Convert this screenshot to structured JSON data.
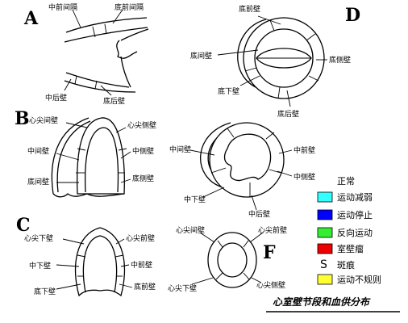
{
  "panels": {
    "A": {
      "letter": "A",
      "labels": {
        "mid_anterior_septum": "中前间隔",
        "basal_anterior_septum": "底前间隔",
        "mid_posterior_wall": "中后壁",
        "basal_posterior_wall": "底后壁"
      }
    },
    "B": {
      "letter": "B",
      "left_labels": {
        "apical_septum": "心尖间壁",
        "apical_lateral": "心尖侧壁",
        "mid_septum": "中间壁",
        "mid_lateral": "中侧壁",
        "basal_septum": "底间壁",
        "basal_lateral": "底侧壁"
      },
      "right_labels": {
        "mid_septum": "中间壁",
        "mid_anterior": "中前壁",
        "mid_lateral": "中侧壁",
        "mid_inferior": "中下壁",
        "mid_posterior": "中后壁"
      }
    },
    "C": {
      "letter": "C",
      "labels": {
        "apical_inferior": "心尖下壁",
        "apical_anterior": "心尖前壁",
        "mid_inferior": "中下壁",
        "mid_anterior": "中前壁",
        "basal_inferior": "底下壁",
        "basal_anterior": "底前壁"
      }
    },
    "D": {
      "letter": "D",
      "labels": {
        "basal_anterior": "底前壁",
        "basal_septum": "底间壁",
        "basal_inferior": "底下壁",
        "basal_lateral": "底侧壁",
        "basal_posterior": "底后壁"
      }
    },
    "F": {
      "letter": "F",
      "labels": {
        "apical_septum": "心尖间壁",
        "apical_anterior": "心尖前壁",
        "apical_inferior": "心尖下壁",
        "apical_lateral": "心尖侧壁"
      }
    }
  },
  "legend": {
    "items": [
      {
        "label": "正常",
        "swatch": "none",
        "color": ""
      },
      {
        "label": "运动减弱",
        "swatch": "box",
        "color": "#33ffff"
      },
      {
        "label": "运动停止",
        "swatch": "box",
        "color": "#0000ff"
      },
      {
        "label": "反向运动",
        "swatch": "box",
        "color": "#33ee33"
      },
      {
        "label": "室壁瘤",
        "swatch": "box",
        "color": "#ee0000"
      },
      {
        "label": "斑痕",
        "swatch": "glyph",
        "glyph": "S",
        "color": ""
      },
      {
        "label": "运动不规则",
        "swatch": "box",
        "color": "#ffff33"
      }
    ]
  },
  "caption": "心室壁节段和血供分布"
}
